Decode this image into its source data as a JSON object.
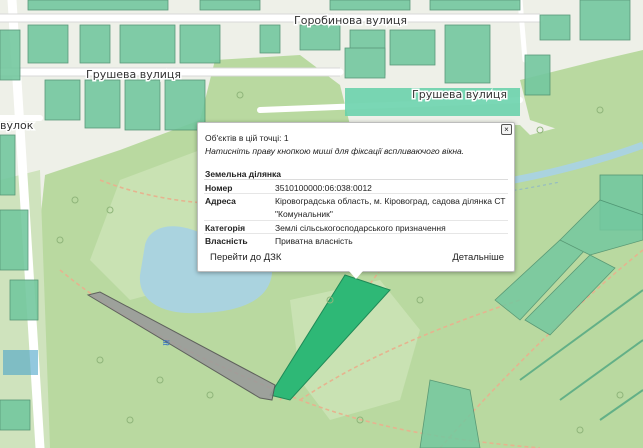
{
  "map": {
    "streets": [
      {
        "name": "Горобинова вулиця"
      },
      {
        "name": "Грушева вулиця"
      },
      {
        "name": "Грушева вулиця"
      },
      {
        "name": "вулок"
      }
    ],
    "colors": {
      "background": "#eef0e8",
      "forest": "#b9d9a0",
      "parcel": "#74c89f",
      "parcel_border": "#4a8f6e",
      "selected_parcel": "#2eb876",
      "water": "#aad3df",
      "road": "#ffffff",
      "path": "#e6b38f",
      "gray_parcel": "#9b9b9b"
    }
  },
  "popup": {
    "objects_count": "Об'єктів в цій точці: 1",
    "hint": "Натисніть праву кнопкою миші для фіксації вспливаючого вікна.",
    "section_title": "Земельна ділянка",
    "fields": [
      {
        "key": "Номер",
        "value": "3510100000:06:038:0012"
      },
      {
        "key": "Адреса",
        "value": "Кіровоградська область, м. Кіровоград, садова ділянка СТ \"Комунальник\""
      },
      {
        "key": "Категорія",
        "value": "Землі сільськогосподарського призначення"
      },
      {
        "key": "Власність",
        "value": "Приватна власність"
      }
    ],
    "address_line1": "Кіровоградська область, м. Кіровоград, садова ділянка СТ",
    "address_line2": "\"Комунальник\"",
    "link_dzk": "Перейти до ДЗК",
    "link_details": "Детальніше",
    "close_label": "×"
  }
}
